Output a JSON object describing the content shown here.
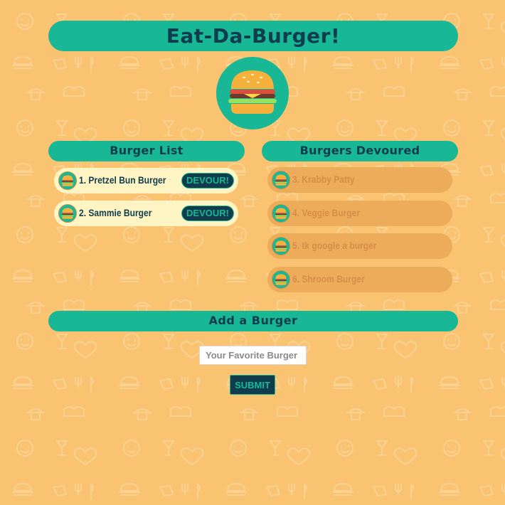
{
  "app": {
    "title": "Eat-Da-Burger!",
    "logo_icon": "burger-icon"
  },
  "lists": {
    "uneaten_header": "Burger List",
    "eaten_header": "Burgers Devoured",
    "uneaten": [
      {
        "label": "1. Pretzel Bun Burger",
        "button": "DEVOUR!"
      },
      {
        "label": "2. Sammie Burger",
        "button": "DEVOUR!"
      }
    ],
    "eaten": [
      {
        "label": "3. Krabby Patty"
      },
      {
        "label": "4. Veggie Burger"
      },
      {
        "label": "5. tk google a burger"
      },
      {
        "label": "6. Shroom Burger"
      }
    ]
  },
  "form": {
    "header": "Add a Burger",
    "placeholder": "Your Favorite Burger",
    "value": "",
    "submit_label": "SUBMIT"
  },
  "colors": {
    "background": "#f9c371",
    "accent": "#18b896",
    "dark": "#0f3d4d",
    "item_uneaten": "#fff5c4",
    "item_eaten": "#edac5a"
  }
}
